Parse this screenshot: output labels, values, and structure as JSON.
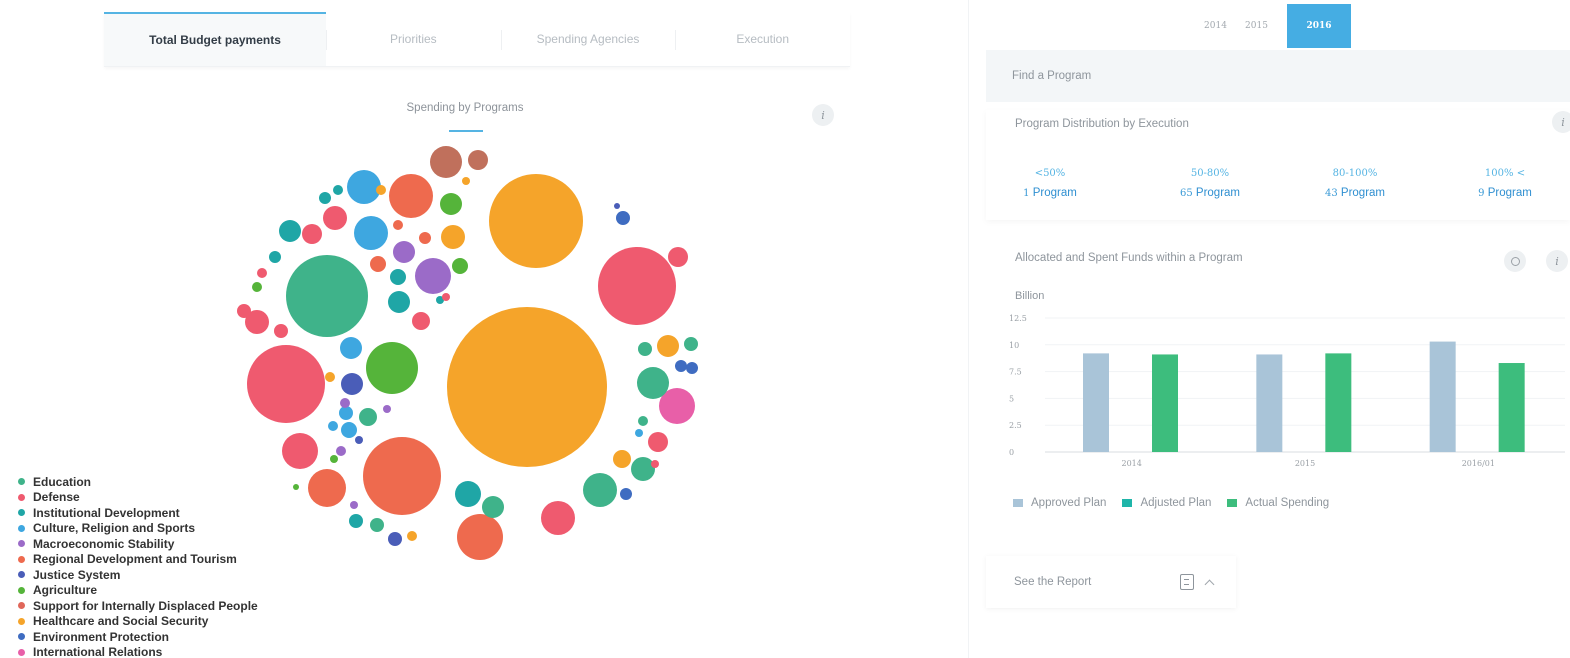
{
  "tabs": [
    {
      "label": "Total Budget payments",
      "active": true
    },
    {
      "label": "Priorities",
      "active": false
    },
    {
      "label": "Spending Agencies",
      "active": false
    },
    {
      "label": "Execution",
      "active": false
    }
  ],
  "bubble_chart": {
    "title": "Spending by Programs",
    "info_label": "i"
  },
  "legend": [
    {
      "label": "Education",
      "color": "#3fb38a"
    },
    {
      "label": "Defense",
      "color": "#ef5a6f"
    },
    {
      "label": "Institutional Development",
      "color": "#1fa6a6"
    },
    {
      "label": "Culture, Religion and Sports",
      "color": "#3ea7e0"
    },
    {
      "label": "Macroeconomic Stability",
      "color": "#9b6bc8"
    },
    {
      "label": "Regional Development and Tourism",
      "color": "#ee6a4e"
    },
    {
      "label": "Justice System",
      "color": "#4a5db8"
    },
    {
      "label": "Agriculture",
      "color": "#55b43a"
    },
    {
      "label": "Support for Internally Displaced People",
      "color": "#e0675a"
    },
    {
      "label": "Healthcare and Social Security",
      "color": "#f5a42a"
    },
    {
      "label": "Environment Protection",
      "color": "#3f6cc1"
    },
    {
      "label": "International Relations",
      "color": "#e85fa8"
    }
  ],
  "years": {
    "items": [
      "2014",
      "2015",
      "2016"
    ],
    "active": "2016"
  },
  "find_program": {
    "placeholder": "Find a Program"
  },
  "distribution": {
    "title": "Program Distribution by Execution",
    "info_label": "i",
    "buckets": [
      {
        "range": "<50%",
        "count": "1",
        "unit": "Program"
      },
      {
        "range": "50-80%",
        "count": "65",
        "unit": "Program"
      },
      {
        "range": "80-100%",
        "count": "43",
        "unit": "Program"
      },
      {
        "range": "100% <",
        "count": "9",
        "unit": "Program"
      }
    ]
  },
  "funds_chart": {
    "title": "Allocated and Spent Funds within a Program",
    "unit": "Billion",
    "info_label": "i"
  },
  "chart_data": {
    "type": "bar",
    "categories": [
      "2014",
      "2015",
      "2016/01"
    ],
    "series": [
      {
        "name": "Approved Plan",
        "color": "#a9c4d8",
        "values": [
          9.2,
          9.1,
          10.3
        ]
      },
      {
        "name": "Adjusted Plan",
        "color": "#1fb5a9",
        "values": [
          null,
          null,
          null
        ]
      },
      {
        "name": "Actual Spending",
        "color": "#3dbd7d",
        "values": [
          9.1,
          9.2,
          8.3
        ]
      }
    ],
    "yticks": [
      "0",
      "2.5",
      "5",
      "7.5",
      "10",
      "12.5"
    ],
    "ylim": [
      0,
      12.5
    ],
    "ylabel": "Billion",
    "legend_position": "bottom-left"
  },
  "report": {
    "label": "See the Report"
  }
}
